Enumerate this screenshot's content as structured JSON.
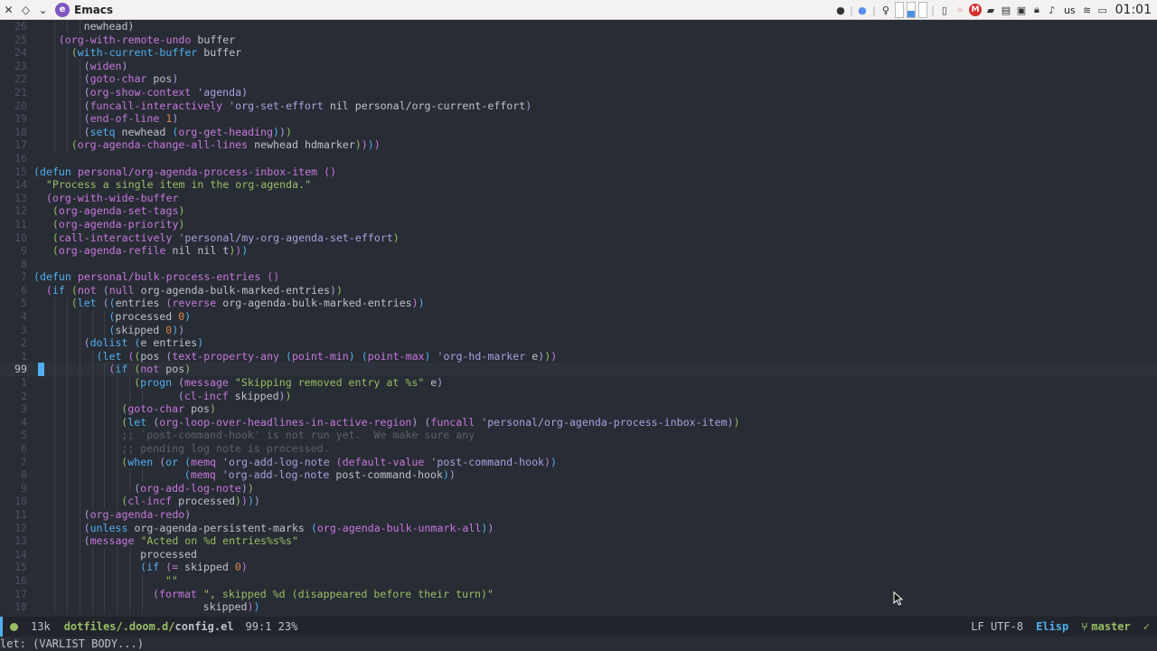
{
  "topbar": {
    "app_name": "Emacs",
    "keyboard_layout": "us",
    "clock": "01:01"
  },
  "editor": {
    "lines": [
      {
        "n": "26",
        "indent": 8,
        "html": "newhead)"
      },
      {
        "n": "25",
        "indent": 4,
        "html": "<span class=\"p2\">(</span><span class=\"fn\">org-with-remote-undo</span> buffer"
      },
      {
        "n": "24",
        "indent": 6,
        "html": "<span class=\"p3\">(</span><span class=\"kw\">with-current-buffer</span> buffer"
      },
      {
        "n": "23",
        "indent": 8,
        "html": "<span class=\"p4\">(</span><span class=\"fn\">widen</span><span class=\"p4\">)</span>"
      },
      {
        "n": "22",
        "indent": 8,
        "html": "<span class=\"p4\">(</span><span class=\"fn\">goto-char</span> pos<span class=\"p4\">)</span>"
      },
      {
        "n": "21",
        "indent": 8,
        "html": "<span class=\"p4\">(</span><span class=\"fn\">org-show-context</span> <span class=\"qt\">'agenda</span><span class=\"p4\">)</span>"
      },
      {
        "n": "20",
        "indent": 8,
        "html": "<span class=\"p4\">(</span><span class=\"fn\">funcall-interactively</span> <span class=\"qt\">'org-set-effort</span> nil personal/org-current-effort<span class=\"p4\">)</span>"
      },
      {
        "n": "19",
        "indent": 8,
        "html": "<span class=\"p4\">(</span><span class=\"fn\">end-of-line</span> <span class=\"num\">1</span><span class=\"p4\">)</span>"
      },
      {
        "n": "18",
        "indent": 8,
        "html": "<span class=\"p4\">(</span><span class=\"kw\">setq</span> newhead <span class=\"p1\">(</span><span class=\"fn\">org-get-heading</span><span class=\"p1\">)</span><span class=\"p4\">)</span><span class=\"p3\">)</span>"
      },
      {
        "n": "17",
        "indent": 6,
        "html": "<span class=\"p3\">(</span><span class=\"fn\">org-agenda-change-all-lines</span> newhead hdmarker<span class=\"p3\">)</span><span class=\"p2\">)</span><span class=\"p1\">)</span><span class=\"p2\">)</span>"
      },
      {
        "n": "16",
        "indent": 0,
        "html": ""
      },
      {
        "n": "15",
        "indent": 0,
        "html": "<span class=\"p1\">(</span><span class=\"kw\">defun</span> <span class=\"fn\">personal/org-agenda-process-inbox-item</span> <span class=\"p2\">()</span>"
      },
      {
        "n": "14",
        "indent": 2,
        "html": "<span class=\"str\">\"Process a single item in the org-agenda.\"</span>"
      },
      {
        "n": "13",
        "indent": 2,
        "html": "<span class=\"p2\">(</span><span class=\"fn\">org-with-wide-buffer</span>"
      },
      {
        "n": "12",
        "indent": 3,
        "html": "<span class=\"p3\">(</span><span class=\"fn\">org-agenda-set-tags</span><span class=\"p3\">)</span>"
      },
      {
        "n": "11",
        "indent": 3,
        "html": "<span class=\"p3\">(</span><span class=\"fn\">org-agenda-priority</span><span class=\"p3\">)</span>"
      },
      {
        "n": "10",
        "indent": 3,
        "html": "<span class=\"p3\">(</span><span class=\"fn\">call-interactively</span> <span class=\"qt\">'personal/my-org-agenda-set-effort</span><span class=\"p3\">)</span>"
      },
      {
        "n": "9",
        "indent": 3,
        "html": "<span class=\"p3\">(</span><span class=\"fn\">org-agenda-refile</span> nil nil t<span class=\"p3\">)</span><span class=\"p2\">)</span><span class=\"p1\">)</span>"
      },
      {
        "n": "8",
        "indent": 0,
        "html": ""
      },
      {
        "n": "7",
        "indent": 0,
        "html": "<span class=\"p1\">(</span><span class=\"kw\">defun</span> <span class=\"fn\">personal/bulk-process-entries</span> <span class=\"p2\">()</span>"
      },
      {
        "n": "6",
        "indent": 2,
        "html": "<span class=\"p2\">(</span><span class=\"kw\">if</span> <span class=\"p3\">(</span><span class=\"fn\">not</span> <span class=\"p4\">(</span><span class=\"fn\">null</span> org-agenda-bulk-marked-entries<span class=\"p4\">)</span><span class=\"p3\">)</span>"
      },
      {
        "n": "5",
        "indent": 6,
        "html": "<span class=\"p3\">(</span><span class=\"kw\">let</span> <span class=\"p4\">(</span><span class=\"p1\">(</span>entries <span class=\"p2\">(</span><span class=\"fn\">reverse</span> org-agenda-bulk-marked-entries<span class=\"p2\">)</span><span class=\"p1\">)</span>"
      },
      {
        "n": "4",
        "indent": 12,
        "html": "<span class=\"p1\">(</span>processed <span class=\"num\">0</span><span class=\"p1\">)</span>"
      },
      {
        "n": "3",
        "indent": 12,
        "html": "<span class=\"p1\">(</span>skipped <span class=\"num\">0</span><span class=\"p1\">)</span><span class=\"p4\">)</span>"
      },
      {
        "n": "2",
        "indent": 8,
        "html": "<span class=\"p4\">(</span><span class=\"kw\">dolist</span> <span class=\"p1\">(</span>e entries<span class=\"p1\">)</span>"
      },
      {
        "n": "1",
        "indent": 10,
        "html": "<span class=\"p1\">(</span><span class=\"kw\">let</span> <span class=\"p2\">(</span><span class=\"p3\">(</span>pos <span class=\"p4\">(</span><span class=\"fn\">text-property-any</span> <span class=\"p1\">(</span><span class=\"fn\">point-min</span><span class=\"p1\">)</span> <span class=\"p1\">(</span><span class=\"fn\">point-max</span><span class=\"p1\">)</span> <span class=\"qt\">'org-hd-marker</span> e<span class=\"p4\">)</span><span class=\"p3\">)</span><span class=\"p2\">)</span>"
      },
      {
        "n": "99",
        "indent": 12,
        "cur": true,
        "html": "<span class=\"p2\">(</span><span class=\"kw\">if</span> <span class=\"p3\">(</span><span class=\"fn\">not</span> pos<span class=\"p3\">)</span>"
      },
      {
        "n": "1",
        "indent": 16,
        "html": "<span class=\"p3\">(</span><span class=\"kw\">progn</span> <span class=\"p4\">(</span><span class=\"fn\">message</span> <span class=\"str\">\"Skipping removed entry at %s\"</span> e<span class=\"p4\">)</span>"
      },
      {
        "n": "2",
        "indent": 23,
        "html": "<span class=\"p4\">(</span><span class=\"fn\">cl-incf</span> skipped<span class=\"p4\">)</span><span class=\"p3\">)</span>"
      },
      {
        "n": "3",
        "indent": 14,
        "html": "<span class=\"p3\">(</span><span class=\"fn\">goto-char</span> pos<span class=\"p3\">)</span>"
      },
      {
        "n": "4",
        "indent": 14,
        "html": "<span class=\"p3\">(</span><span class=\"kw\">let</span> <span class=\"p4\">(</span><span class=\"fn\">org-loop-over-headlines-in-active-region</span><span class=\"p4\">)</span> <span class=\"p4\">(</span><span class=\"fn\">funcall</span> <span class=\"qt\">'personal/org-agenda-process-inbox-item</span><span class=\"p4\">)</span><span class=\"p3\">)</span>"
      },
      {
        "n": "5",
        "indent": 14,
        "html": "<span class=\"cm\">;; `post-command-hook' is not run yet.  We make sure any</span>"
      },
      {
        "n": "6",
        "indent": 14,
        "html": "<span class=\"cm\">;; pending log note is processed.</span>"
      },
      {
        "n": "7",
        "indent": 14,
        "html": "<span class=\"p3\">(</span><span class=\"kw\">when</span> <span class=\"p4\">(</span><span class=\"kw\">or</span> <span class=\"p1\">(</span><span class=\"fn\">memq</span> <span class=\"qt\">'org-add-log-note</span> <span class=\"p2\">(</span><span class=\"fn\">default-value</span> <span class=\"qt\">'post-command-hook</span><span class=\"p2\">)</span><span class=\"p1\">)</span>"
      },
      {
        "n": "8",
        "indent": 24,
        "html": "<span class=\"p1\">(</span><span class=\"fn\">memq</span> <span class=\"qt\">'org-add-log-note</span> post-command-hook<span class=\"p1\">)</span><span class=\"p4\">)</span>"
      },
      {
        "n": "9",
        "indent": 16,
        "html": "<span class=\"p4\">(</span><span class=\"fn\">org-add-log-note</span><span class=\"p4\">)</span><span class=\"p3\">)</span>"
      },
      {
        "n": "10",
        "indent": 14,
        "html": "<span class=\"p3\">(</span><span class=\"fn\">cl-incf</span> processed<span class=\"p3\">)</span><span class=\"p2\">)</span><span class=\"p1\">)</span><span class=\"p4\">)</span>"
      },
      {
        "n": "11",
        "indent": 8,
        "html": "<span class=\"p4\">(</span><span class=\"fn\">org-agenda-redo</span><span class=\"p4\">)</span>"
      },
      {
        "n": "12",
        "indent": 8,
        "html": "<span class=\"p4\">(</span><span class=\"kw\">unless</span> org-agenda-persistent-marks <span class=\"p1\">(</span><span class=\"fn\">org-agenda-bulk-unmark-all</span><span class=\"p1\">)</span><span class=\"p4\">)</span>"
      },
      {
        "n": "13",
        "indent": 8,
        "html": "<span class=\"p4\">(</span><span class=\"fn\">message</span> <span class=\"str\">\"Acted on %d entries%s%s\"</span>"
      },
      {
        "n": "14",
        "indent": 17,
        "html": "processed"
      },
      {
        "n": "15",
        "indent": 17,
        "html": "<span class=\"p1\">(</span><span class=\"kw\">if</span> <span class=\"p2\">(</span><span class=\"fn\">=</span> skipped <span class=\"num\">0</span><span class=\"p2\">)</span>"
      },
      {
        "n": "16",
        "indent": 21,
        "html": "<span class=\"str\">\"\"</span>"
      },
      {
        "n": "17",
        "indent": 19,
        "html": "<span class=\"p2\">(</span><span class=\"fn\">format</span> <span class=\"str\">\", skipped %d (disappeared before their turn)\"</span>"
      },
      {
        "n": "18",
        "indent": 27,
        "html": "skipped<span class=\"p2\">)</span><span class=\"p1\">)</span>"
      }
    ]
  },
  "modeline": {
    "size": "13k",
    "dir": "dotfiles/.doom.d/",
    "file": "config.el",
    "position": "99:1 23%",
    "eol_encoding": "LF UTF-8",
    "major_mode": "Elisp",
    "branch": "master"
  },
  "echo": {
    "text": "let: (VARLIST BODY...)"
  },
  "colors": {
    "background": "#282c34",
    "foreground": "#bbc2cf",
    "modeline_bg": "#21242b",
    "accent_blue": "#51afef",
    "accent_green": "#98be65"
  }
}
